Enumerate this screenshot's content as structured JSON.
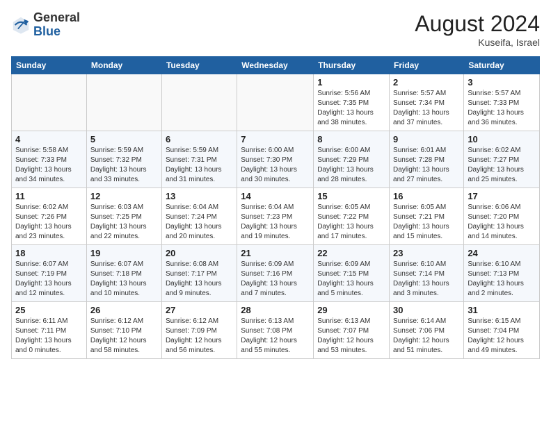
{
  "header": {
    "logo_general": "General",
    "logo_blue": "Blue",
    "title": "August 2024",
    "location": "Kuseifa, Israel"
  },
  "weekdays": [
    "Sunday",
    "Monday",
    "Tuesday",
    "Wednesday",
    "Thursday",
    "Friday",
    "Saturday"
  ],
  "weeks": [
    [
      {
        "day": "",
        "info": ""
      },
      {
        "day": "",
        "info": ""
      },
      {
        "day": "",
        "info": ""
      },
      {
        "day": "",
        "info": ""
      },
      {
        "day": "1",
        "info": "Sunrise: 5:56 AM\nSunset: 7:35 PM\nDaylight: 13 hours\nand 38 minutes."
      },
      {
        "day": "2",
        "info": "Sunrise: 5:57 AM\nSunset: 7:34 PM\nDaylight: 13 hours\nand 37 minutes."
      },
      {
        "day": "3",
        "info": "Sunrise: 5:57 AM\nSunset: 7:33 PM\nDaylight: 13 hours\nand 36 minutes."
      }
    ],
    [
      {
        "day": "4",
        "info": "Sunrise: 5:58 AM\nSunset: 7:33 PM\nDaylight: 13 hours\nand 34 minutes."
      },
      {
        "day": "5",
        "info": "Sunrise: 5:59 AM\nSunset: 7:32 PM\nDaylight: 13 hours\nand 33 minutes."
      },
      {
        "day": "6",
        "info": "Sunrise: 5:59 AM\nSunset: 7:31 PM\nDaylight: 13 hours\nand 31 minutes."
      },
      {
        "day": "7",
        "info": "Sunrise: 6:00 AM\nSunset: 7:30 PM\nDaylight: 13 hours\nand 30 minutes."
      },
      {
        "day": "8",
        "info": "Sunrise: 6:00 AM\nSunset: 7:29 PM\nDaylight: 13 hours\nand 28 minutes."
      },
      {
        "day": "9",
        "info": "Sunrise: 6:01 AM\nSunset: 7:28 PM\nDaylight: 13 hours\nand 27 minutes."
      },
      {
        "day": "10",
        "info": "Sunrise: 6:02 AM\nSunset: 7:27 PM\nDaylight: 13 hours\nand 25 minutes."
      }
    ],
    [
      {
        "day": "11",
        "info": "Sunrise: 6:02 AM\nSunset: 7:26 PM\nDaylight: 13 hours\nand 23 minutes."
      },
      {
        "day": "12",
        "info": "Sunrise: 6:03 AM\nSunset: 7:25 PM\nDaylight: 13 hours\nand 22 minutes."
      },
      {
        "day": "13",
        "info": "Sunrise: 6:04 AM\nSunset: 7:24 PM\nDaylight: 13 hours\nand 20 minutes."
      },
      {
        "day": "14",
        "info": "Sunrise: 6:04 AM\nSunset: 7:23 PM\nDaylight: 13 hours\nand 19 minutes."
      },
      {
        "day": "15",
        "info": "Sunrise: 6:05 AM\nSunset: 7:22 PM\nDaylight: 13 hours\nand 17 minutes."
      },
      {
        "day": "16",
        "info": "Sunrise: 6:05 AM\nSunset: 7:21 PM\nDaylight: 13 hours\nand 15 minutes."
      },
      {
        "day": "17",
        "info": "Sunrise: 6:06 AM\nSunset: 7:20 PM\nDaylight: 13 hours\nand 14 minutes."
      }
    ],
    [
      {
        "day": "18",
        "info": "Sunrise: 6:07 AM\nSunset: 7:19 PM\nDaylight: 13 hours\nand 12 minutes."
      },
      {
        "day": "19",
        "info": "Sunrise: 6:07 AM\nSunset: 7:18 PM\nDaylight: 13 hours\nand 10 minutes."
      },
      {
        "day": "20",
        "info": "Sunrise: 6:08 AM\nSunset: 7:17 PM\nDaylight: 13 hours\nand 9 minutes."
      },
      {
        "day": "21",
        "info": "Sunrise: 6:09 AM\nSunset: 7:16 PM\nDaylight: 13 hours\nand 7 minutes."
      },
      {
        "day": "22",
        "info": "Sunrise: 6:09 AM\nSunset: 7:15 PM\nDaylight: 13 hours\nand 5 minutes."
      },
      {
        "day": "23",
        "info": "Sunrise: 6:10 AM\nSunset: 7:14 PM\nDaylight: 13 hours\nand 3 minutes."
      },
      {
        "day": "24",
        "info": "Sunrise: 6:10 AM\nSunset: 7:13 PM\nDaylight: 13 hours\nand 2 minutes."
      }
    ],
    [
      {
        "day": "25",
        "info": "Sunrise: 6:11 AM\nSunset: 7:11 PM\nDaylight: 13 hours\nand 0 minutes."
      },
      {
        "day": "26",
        "info": "Sunrise: 6:12 AM\nSunset: 7:10 PM\nDaylight: 12 hours\nand 58 minutes."
      },
      {
        "day": "27",
        "info": "Sunrise: 6:12 AM\nSunset: 7:09 PM\nDaylight: 12 hours\nand 56 minutes."
      },
      {
        "day": "28",
        "info": "Sunrise: 6:13 AM\nSunset: 7:08 PM\nDaylight: 12 hours\nand 55 minutes."
      },
      {
        "day": "29",
        "info": "Sunrise: 6:13 AM\nSunset: 7:07 PM\nDaylight: 12 hours\nand 53 minutes."
      },
      {
        "day": "30",
        "info": "Sunrise: 6:14 AM\nSunset: 7:06 PM\nDaylight: 12 hours\nand 51 minutes."
      },
      {
        "day": "31",
        "info": "Sunrise: 6:15 AM\nSunset: 7:04 PM\nDaylight: 12 hours\nand 49 minutes."
      }
    ]
  ]
}
